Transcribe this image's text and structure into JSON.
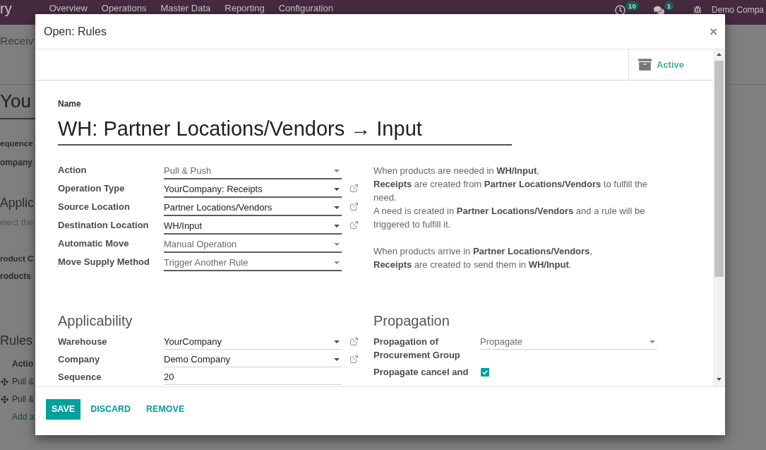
{
  "top_bar": {
    "app_name": "ry",
    "menu": [
      "Overview",
      "Operations",
      "Master Data",
      "Reporting",
      "Configuration"
    ],
    "activity_count": "10",
    "message_count": "1",
    "company": "Demo Compa"
  },
  "background": {
    "breadcrumb": "Receiv",
    "title": "You",
    "labels_1": [
      "equence",
      "ompany"
    ],
    "section": "Applic",
    "hint": "elect the",
    "labels_2": [
      "roduct C",
      "roducts"
    ],
    "rules_title": "Rules",
    "rules_header": "Actio",
    "rules_rows": [
      "Pull &",
      "Pull &"
    ],
    "add_line": "Add a"
  },
  "dialog": {
    "title": "Open: Rules",
    "close": "×",
    "status_button": {
      "label": "Active",
      "on": true
    },
    "name_label": "Name",
    "name": "WH: Partner Locations/Vendors → Input",
    "fields": [
      {
        "label": "Action",
        "value": "Pull & Push",
        "kind": "select",
        "required": true
      },
      {
        "label": "Operation Type",
        "value": "YourCompany: Receipts",
        "kind": "relation",
        "required": true
      },
      {
        "label": "Source Location",
        "value": "Partner Locations/Vendors",
        "kind": "relation",
        "required": true
      },
      {
        "label": "Destination Location",
        "value": "WH/Input",
        "kind": "relation",
        "required": true
      },
      {
        "label": "Automatic Move",
        "value": "Manual Operation",
        "kind": "select",
        "required": true
      },
      {
        "label": "Move Supply Method",
        "value": "Trigger Another Rule",
        "kind": "select",
        "required": true
      }
    ],
    "help": [
      {
        "lines": [
          "When products are needed in **WH/Input**,",
          "**Receipts** are created from **Partner Locations/Vendors** to fulfill the need.",
          "A need is created in **Partner Locations/Vendors** and a rule will be triggered to fulfill it."
        ]
      },
      {
        "lines": [
          "When products arrive in **Partner Locations/Vendors**,",
          "**Receipts** are created to send them in **WH/Input**."
        ]
      }
    ],
    "applicability": {
      "title": "Applicability",
      "fields": [
        {
          "label": "Warehouse",
          "value": "YourCompany",
          "kind": "relation",
          "required": false
        },
        {
          "label": "Company",
          "value": "Demo Company",
          "kind": "relation",
          "required": false
        },
        {
          "label": "Sequence",
          "value": "20",
          "kind": "text",
          "required": false
        }
      ]
    },
    "propagation": {
      "title": "Propagation",
      "fields": [
        {
          "label": "Propagation of Procurement Group",
          "value": "Propagate",
          "kind": "select",
          "required": false
        },
        {
          "label": "Propagate cancel and",
          "kind": "checkbox",
          "checked": true
        }
      ]
    },
    "buttons": [
      {
        "label": "SAVE",
        "kind": "primary"
      },
      {
        "label": "DISCARD",
        "kind": "link"
      },
      {
        "label": "REMOVE",
        "kind": "link"
      }
    ]
  }
}
